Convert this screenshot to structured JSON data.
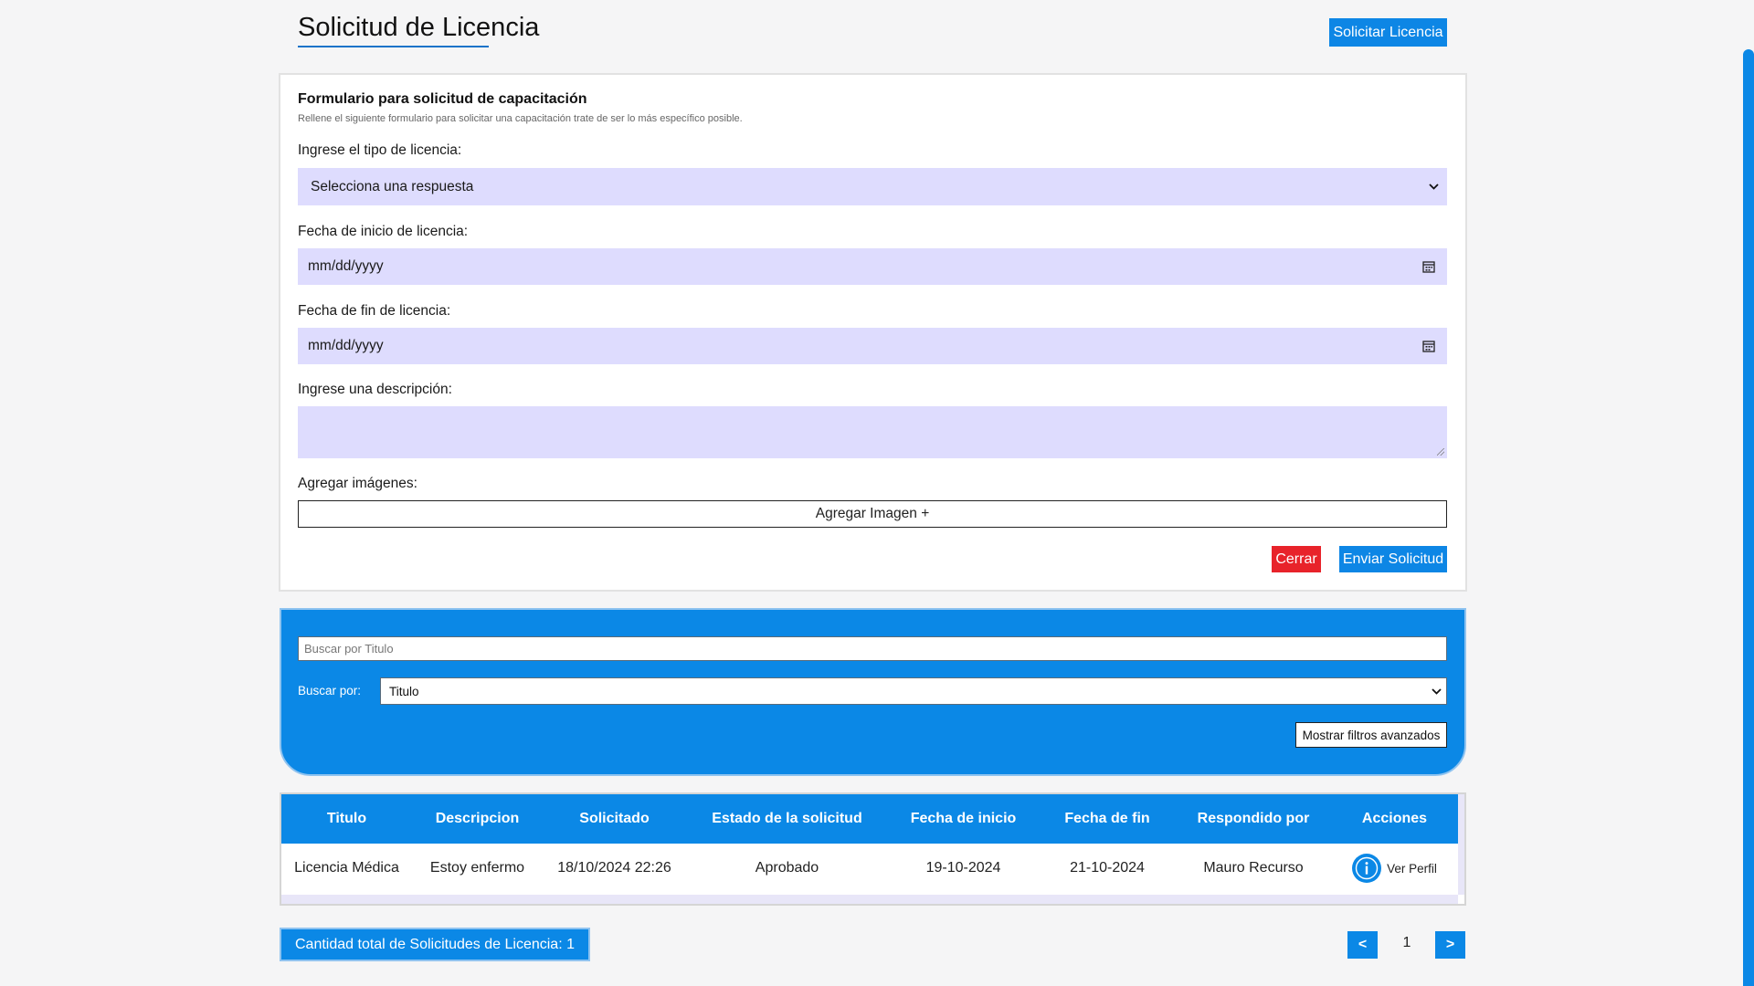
{
  "header": {
    "title": "Solicitud de Licencia",
    "request_button": "Solicitar Licencia"
  },
  "form": {
    "heading": "Formulario para solicitud de capacitación",
    "subheading": "Rellene el siguiente formulario para solicitar una capacitación trate de ser lo más específico posible.",
    "type_label": "Ingrese el tipo de licencia:",
    "type_value": "Selecciona una respuesta",
    "start_label": "Fecha de inicio de licencia:",
    "start_value": "mm/dd/yyyy",
    "end_label": "Fecha de fin de licencia:",
    "end_value": "mm/dd/yyyy",
    "description_label": "Ingrese una descripción:",
    "description_value": "",
    "images_label": "Agregar imágenes:",
    "add_image_button": "Agregar Imagen +",
    "close_button": "Cerrar",
    "submit_button": "Enviar Solicitud"
  },
  "search": {
    "placeholder": "Buscar por Titulo",
    "by_label": "Buscar por:",
    "by_value": "Titulo",
    "advanced_filters_button": "Mostrar filtros avanzados"
  },
  "table": {
    "headers": [
      "Titulo",
      "Descripcion",
      "Solicitado",
      "Estado de la solicitud",
      "Fecha de inicio",
      "Fecha de fin",
      "Respondido por",
      "Acciones"
    ],
    "rows": [
      {
        "titulo": "Licencia Médica",
        "descripcion": "Estoy enfermo",
        "solicitado": "18/10/2024 22:26",
        "estado": "Aprobado",
        "fecha_inicio": "19-10-2024",
        "fecha_fin": "21-10-2024",
        "respondido_por": "Mauro Recurso",
        "accion": "Ver Perfil"
      }
    ]
  },
  "footer": {
    "total_text": "Cantidad total de Solicitudes de Licencia: 1",
    "prev": "<",
    "page": "1",
    "next": ">"
  },
  "icons": {
    "chevron": "chevron-down-icon",
    "calendar": "calendar-icon",
    "info": "info-icon"
  },
  "colors": {
    "primary": "#0b88e6",
    "danger": "#e8232a",
    "field": "#dedcfe"
  }
}
